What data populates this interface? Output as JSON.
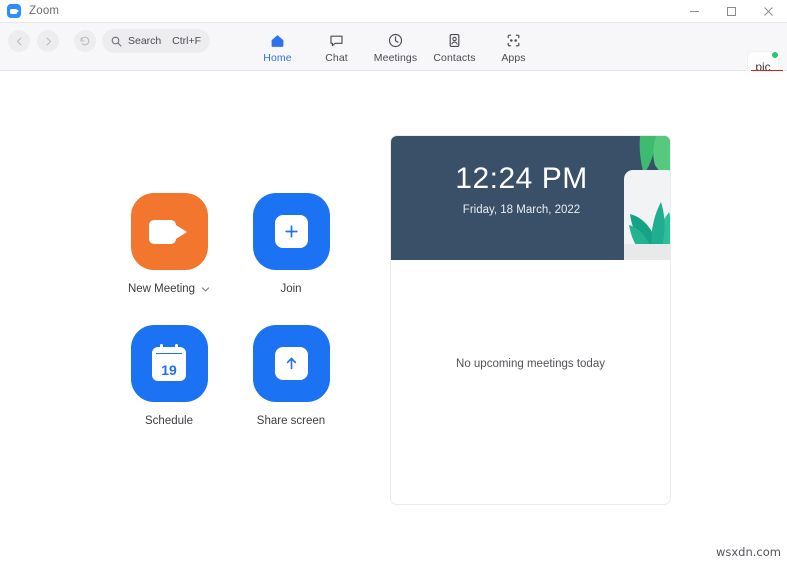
{
  "window": {
    "title": "Zoom",
    "logo_icon": "zoom-logo-icon",
    "controls": {
      "minimize": "minimize-icon",
      "maximize": "maximize-icon",
      "close": "close-icon"
    }
  },
  "toolbar": {
    "back_icon": "chevron-left-icon",
    "forward_icon": "chevron-right-icon",
    "history_icon": "clock-rewind-icon",
    "search": {
      "icon": "search-icon",
      "placeholder": "Search",
      "shortcut": "Ctrl+F"
    },
    "tabs": [
      {
        "label": "Home",
        "icon": "home-icon",
        "active": true
      },
      {
        "label": "Chat",
        "icon": "chat-bubble-icon",
        "active": false
      },
      {
        "label": "Meetings",
        "icon": "clock-icon",
        "active": false
      },
      {
        "label": "Contacts",
        "icon": "person-card-icon",
        "active": false
      },
      {
        "label": "Apps",
        "icon": "apps-grid-icon",
        "active": false
      }
    ],
    "avatar": {
      "text": "pic",
      "status": "available"
    }
  },
  "settings": {
    "icon": "gear-icon",
    "highlight_color": "#e01b1b"
  },
  "actions": [
    {
      "label": "New Meeting",
      "icon": "video-camera-icon",
      "color": "#f2762e",
      "has_dropdown": true,
      "dropdown_icon": "chevron-down-icon"
    },
    {
      "label": "Join",
      "icon": "plus-icon",
      "color": "#1b72f2",
      "has_dropdown": false
    },
    {
      "label": "Schedule",
      "icon": "calendar-icon",
      "color": "#1b72f2",
      "calendar_day": "19",
      "has_dropdown": false
    },
    {
      "label": "Share screen",
      "icon": "arrow-up-icon",
      "color": "#1b72f2",
      "has_dropdown": false
    }
  ],
  "panel": {
    "time": "12:24 PM",
    "date": "Friday, 18 March, 2022",
    "hero_background": "#3a5068",
    "empty_state": "No upcoming meetings today",
    "decoration_icon": "potted-plant-illustration"
  },
  "watermark": "wsxdn.com"
}
